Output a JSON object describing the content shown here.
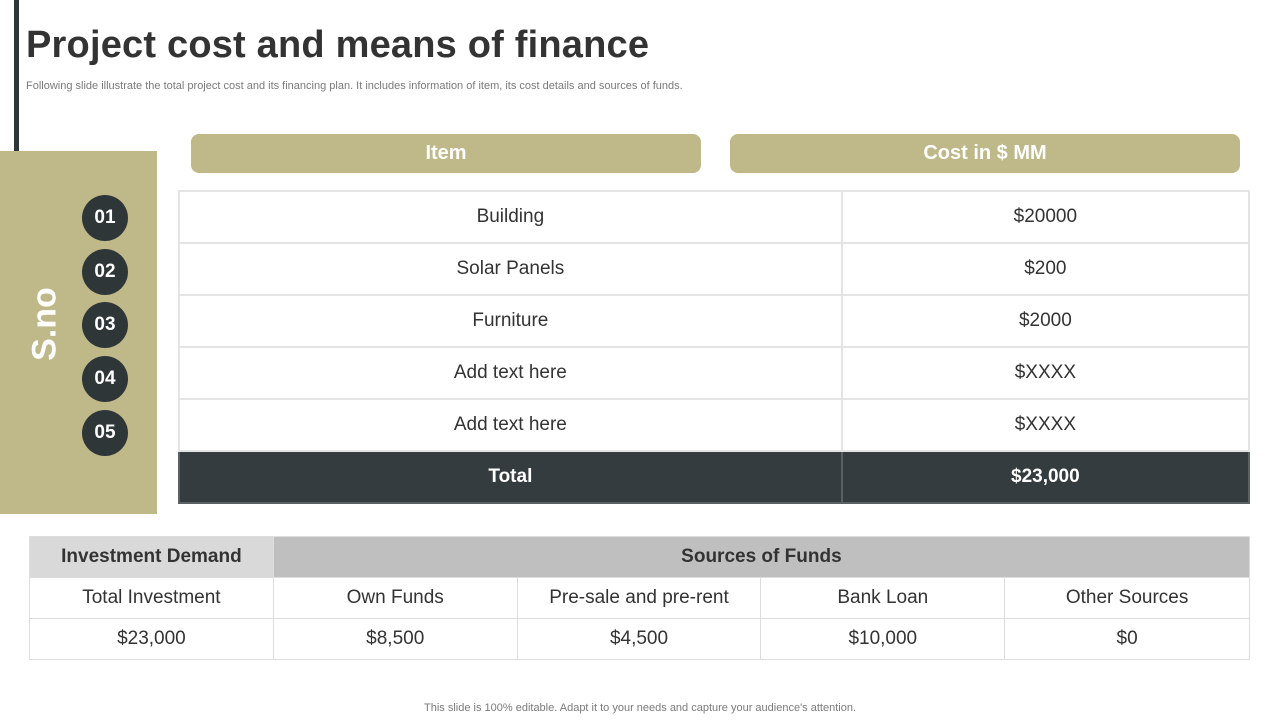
{
  "slide": {
    "title": "Project cost and means of finance",
    "subtitle": "Following slide illustrate the total project cost and its financing plan. It includes information of item, its cost details and sources of funds.",
    "side_label": "S.no",
    "footer": "This slide is 100% editable. Adapt it to your needs and capture your audience's attention."
  },
  "cost_table": {
    "headers": {
      "item": "Item",
      "cost": "Cost in $ MM"
    },
    "rows": [
      {
        "num": "01",
        "item": "Building",
        "cost": "$20000"
      },
      {
        "num": "02",
        "item": "Solar Panels",
        "cost": "$200"
      },
      {
        "num": "03",
        "item": "Furniture",
        "cost": "$2000"
      },
      {
        "num": "04",
        "item": "Add text here",
        "cost": "$XXXX"
      },
      {
        "num": "05",
        "item": "Add text here",
        "cost": "$XXXX"
      }
    ],
    "total": {
      "label": "Total",
      "value": "$23,000"
    }
  },
  "funds_table": {
    "header_demand": "Investment Demand",
    "header_sources": "Sources of Funds",
    "columns": [
      "Total Investment",
      "Own Funds",
      "Pre-sale and pre-rent",
      "Bank Loan",
      "Other Sources"
    ],
    "values": [
      "$23,000",
      "$8,500",
      "$4,500",
      "$10,000",
      "$0"
    ]
  },
  "colors": {
    "accent": "#bfb888",
    "dark": "#343c3f",
    "header_gray": "#d9d9d9",
    "header_gray_dark": "#bfbfbf"
  }
}
